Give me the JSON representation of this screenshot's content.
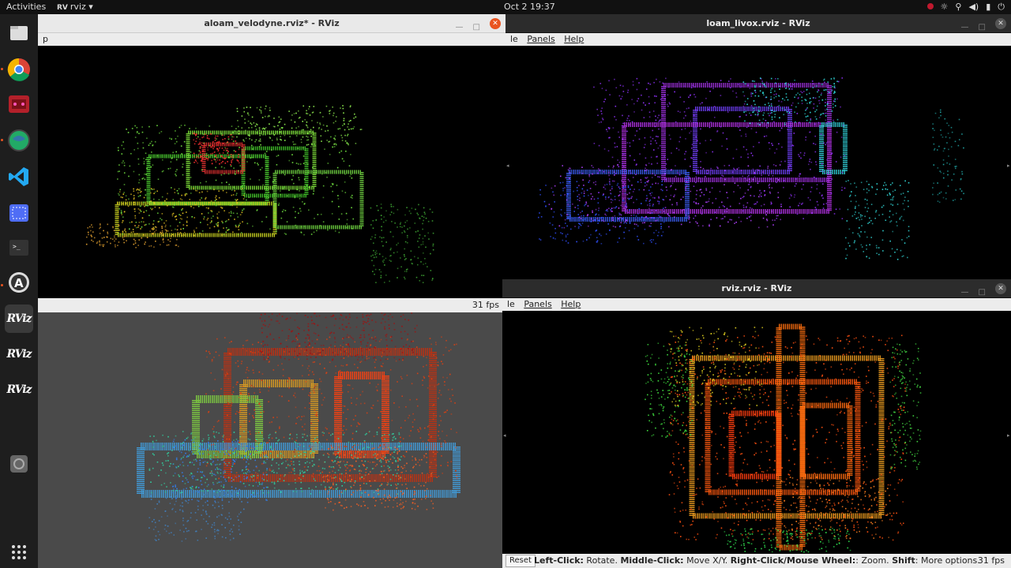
{
  "topbar": {
    "activities": "Activities",
    "app_name": "rviz",
    "app_icon_text": "RV",
    "clock": "Oct 2  19:37"
  },
  "dock": {
    "items": [
      {
        "name": "files"
      },
      {
        "name": "chrome"
      },
      {
        "name": "app-red"
      },
      {
        "name": "app-globe"
      },
      {
        "name": "vscode"
      },
      {
        "name": "screenshot"
      },
      {
        "name": "terminal"
      },
      {
        "name": "software-center"
      },
      {
        "name": "rviz-1",
        "label": "RViz"
      },
      {
        "name": "rviz-2",
        "label": "RViz"
      },
      {
        "name": "rviz-3",
        "label": "RViz"
      },
      {
        "name": "disk"
      },
      {
        "name": "show-apps"
      }
    ]
  },
  "windows": {
    "aloam": {
      "title": "aloam_velodyne.rviz* - RViz",
      "menu_fragment": "p",
      "fps": "31 fps"
    },
    "livox": {
      "title": "loam_livox.rviz - RViz",
      "menu": [
        "le",
        "Panels",
        "Help"
      ]
    },
    "rviz": {
      "title": "rviz.rviz - RViz",
      "menu": [
        "le",
        "Panels",
        "Help"
      ],
      "reset": "Reset",
      "help_parts": [
        {
          "b": "Left-Click:",
          "t": " Rotate. "
        },
        {
          "b": "Middle-Click:",
          "t": " Move X/Y. "
        },
        {
          "b": "Right-Click/Mouse Wheel:",
          "t": ": Zoom. "
        },
        {
          "b": "Shift",
          "t": ": More options."
        }
      ],
      "fps": "31 fps"
    }
  },
  "colors": {
    "accent": "#e95420",
    "topbar": "#111111",
    "dock": "#1e1e1e",
    "title_light": "#e9e9e9",
    "title_dark": "#2c2c2c",
    "gray_bg": "#4a4a4a"
  }
}
